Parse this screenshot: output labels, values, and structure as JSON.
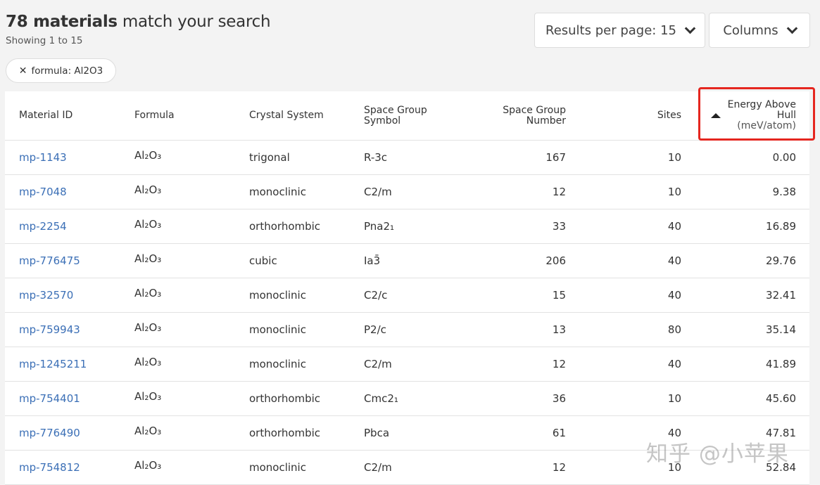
{
  "header": {
    "count_bold": "78 materials",
    "title_rest": " match your search",
    "showing": "Showing 1 to 15"
  },
  "filter_chip": {
    "label": "formula: Al2O3",
    "icon": "close-icon"
  },
  "controls": {
    "results_per_page": "Results per page: 15",
    "columns": "Columns"
  },
  "colors": {
    "link": "#3b6fb6",
    "highlight": "#e5261f"
  },
  "table": {
    "headers": {
      "material_id": "Material ID",
      "formula": "Formula",
      "crystal_system": "Crystal System",
      "sg_symbol_1": "Space Group",
      "sg_symbol_2": "Symbol",
      "sg_number_1": "Space Group",
      "sg_number_2": "Number",
      "sites": "Sites",
      "energy_1": "Energy Above",
      "energy_2": "Hull",
      "energy_unit": "(meV/atom)",
      "sort": "ascending"
    },
    "rows": [
      {
        "id": "mp-1143",
        "formula": "Al₂O₃",
        "crystal": "trigonal",
        "symbol": "R-3c",
        "number": "167",
        "sites": "10",
        "energy": "0.00"
      },
      {
        "id": "mp-7048",
        "formula": "Al₂O₃",
        "crystal": "monoclinic",
        "symbol": "C2/m",
        "number": "12",
        "sites": "10",
        "energy": "9.38"
      },
      {
        "id": "mp-2254",
        "formula": "Al₂O₃",
        "crystal": "orthorhombic",
        "symbol": "Pna2₁",
        "number": "33",
        "sites": "40",
        "energy": "16.89"
      },
      {
        "id": "mp-776475",
        "formula": "Al₂O₃",
        "crystal": "cubic",
        "symbol": "Ia3̄",
        "number": "206",
        "sites": "40",
        "energy": "29.76"
      },
      {
        "id": "mp-32570",
        "formula": "Al₂O₃",
        "crystal": "monoclinic",
        "symbol": "C2/c",
        "number": "15",
        "sites": "40",
        "energy": "32.41"
      },
      {
        "id": "mp-759943",
        "formula": "Al₂O₃",
        "crystal": "monoclinic",
        "symbol": "P2/c",
        "number": "13",
        "sites": "80",
        "energy": "35.14"
      },
      {
        "id": "mp-1245211",
        "formula": "Al₂O₃",
        "crystal": "monoclinic",
        "symbol": "C2/m",
        "number": "12",
        "sites": "40",
        "energy": "41.89"
      },
      {
        "id": "mp-754401",
        "formula": "Al₂O₃",
        "crystal": "orthorhombic",
        "symbol": "Cmc2₁",
        "number": "36",
        "sites": "10",
        "energy": "45.60"
      },
      {
        "id": "mp-776490",
        "formula": "Al₂O₃",
        "crystal": "orthorhombic",
        "symbol": "Pbca",
        "number": "61",
        "sites": "40",
        "energy": "47.81"
      },
      {
        "id": "mp-754812",
        "formula": "Al₂O₃",
        "crystal": "monoclinic",
        "symbol": "C2/m",
        "number": "12",
        "sites": "10",
        "energy": "52.84"
      }
    ]
  },
  "watermark": "知乎 @小苹果"
}
